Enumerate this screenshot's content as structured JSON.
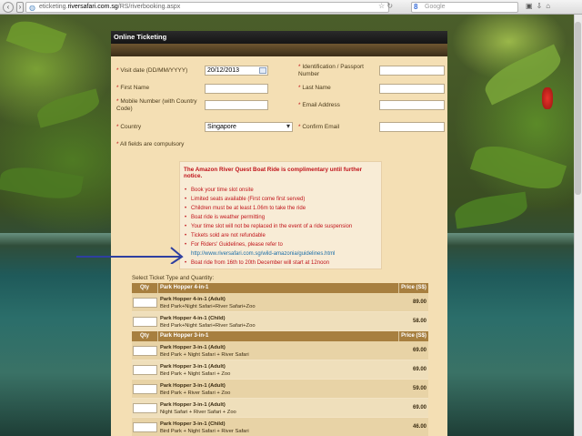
{
  "browser": {
    "url_prefix": "eticketing.",
    "url_host": "riversafari.com.sg",
    "url_path": "/RS/riverbooking.aspx",
    "search_placeholder": "Google",
    "search_engine_letter": "8"
  },
  "page": {
    "header_title": "Online Ticketing",
    "form": {
      "visit_date_label": "Visit date (DD/MM/YYYY)",
      "visit_date_value": "20/12/2013",
      "id_label": "Identification / Passport Number",
      "first_name_label": "First Name",
      "last_name_label": "Last Name",
      "mobile_label": "Mobile Number (with Country Code)",
      "email_label": "Email Address",
      "country_label": "Country",
      "country_value": "Singapore",
      "confirm_email_label": "Confirm Email",
      "required_note": "All fields are compulsory",
      "required_mark": "*"
    },
    "notice": {
      "title": "The Amazon River Quest Boat Ride is complimentary until further notice.",
      "items": [
        "Book your time slot onsite",
        "Limited seats available (First come first served)",
        "Children must be at least 1.06m to take the ride",
        "Boat ride is weather permitting",
        "Your time slot will not be replaced in the event of a ride suspension",
        "Tickets sold are not refundable",
        "For Riders' Guidelines, please refer to",
        "http://www.riversafari.com.sg/wild-amazonia/guidelines.html",
        "Boat ride from 16th to 20th December will start at 12noon"
      ]
    },
    "tickets": {
      "select_title": "Select Ticket Type and Quantity:",
      "col_qty": "Qty",
      "col_price": "Price (S$)",
      "groups": [
        {
          "name": "Park Hopper 4-in-1",
          "rows": [
            {
              "name": "Park Hopper 4-in-1 (Adult)",
              "desc": "Bird Park+Night Safari+River Safari+Zoo",
              "price": "89.00"
            },
            {
              "name": "Park Hopper 4-in-1 (Child)",
              "desc": "Bird Park+Night Safari+River Safari+Zoo",
              "price": "58.00"
            }
          ]
        },
        {
          "name": "Park Hopper 3-in-1",
          "rows": [
            {
              "name": "Park Hopper 3-in-1 (Adult)",
              "desc": "Bird Park + Night Safari + River Safari",
              "price": "69.00"
            },
            {
              "name": "Park Hopper 3-in-1 (Adult)",
              "desc": "Bird Park + Night Safari + Zoo",
              "price": "69.00"
            },
            {
              "name": "Park Hopper 3-in-1 (Adult)",
              "desc": "Bird Park + River Safari + Zoo",
              "price": "59.00"
            },
            {
              "name": "Park Hopper 3-in-1 (Adult)",
              "desc": "Night Safari + River Safari + Zoo",
              "price": "69.00"
            },
            {
              "name": "Park Hopper 3-in-1 (Child)",
              "desc": "Bird Park + Night Safari + River Safari",
              "price": "46.00"
            }
          ]
        }
      ]
    }
  },
  "colors": {
    "accent_red": "#c0141b",
    "link_blue": "#1d6fa8",
    "table_header": "#a77f3f",
    "arrow_blue": "#2e3fa0"
  }
}
